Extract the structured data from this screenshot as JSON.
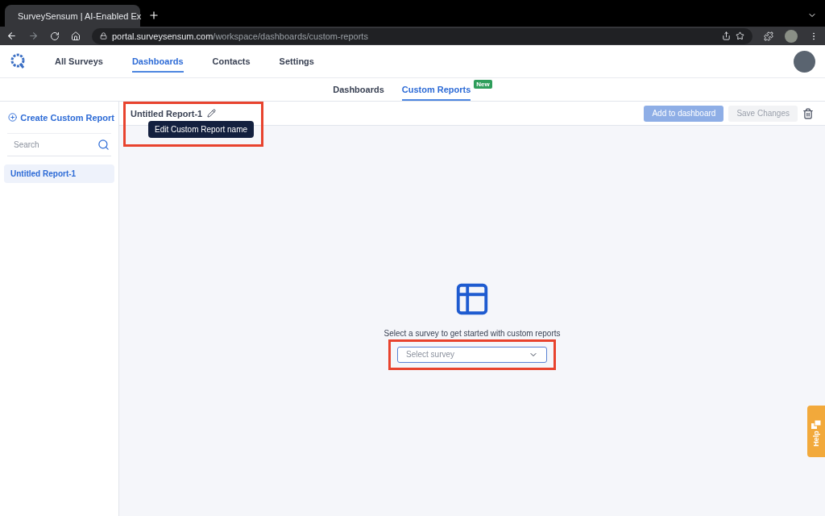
{
  "browser": {
    "tab_title": "SurveySensum | AI-Enabled Ex",
    "url_host": "portal.surveysensum.com",
    "url_path": "/workspace/dashboards/custom-reports"
  },
  "nav": [
    {
      "label": "All Surveys",
      "selected": false
    },
    {
      "label": "Dashboards",
      "selected": true
    },
    {
      "label": "Contacts",
      "selected": false
    },
    {
      "label": "Settings",
      "selected": false
    }
  ],
  "subnav": [
    {
      "label": "Dashboards",
      "selected": false
    },
    {
      "label": "Custom Reports",
      "selected": true,
      "badge": "New"
    }
  ],
  "sidebar": {
    "create_label": "Create Custom Report",
    "search": {
      "placeholder": "Search"
    },
    "reports": [
      {
        "label": "Untitled Report-1",
        "selected": true
      }
    ]
  },
  "report": {
    "title": "Untitled Report-1",
    "tooltip": "Edit Custom Report name",
    "actions": [
      {
        "label": "Add to dashboard",
        "kind": "primary",
        "disabled": true
      },
      {
        "label": "Save Changes",
        "kind": "secondary",
        "disabled": true
      }
    ]
  },
  "empty_state": {
    "message": "Select a survey to get started with custom reports",
    "select": {
      "placeholder": "Select survey"
    }
  },
  "help": {
    "label": "Help"
  }
}
